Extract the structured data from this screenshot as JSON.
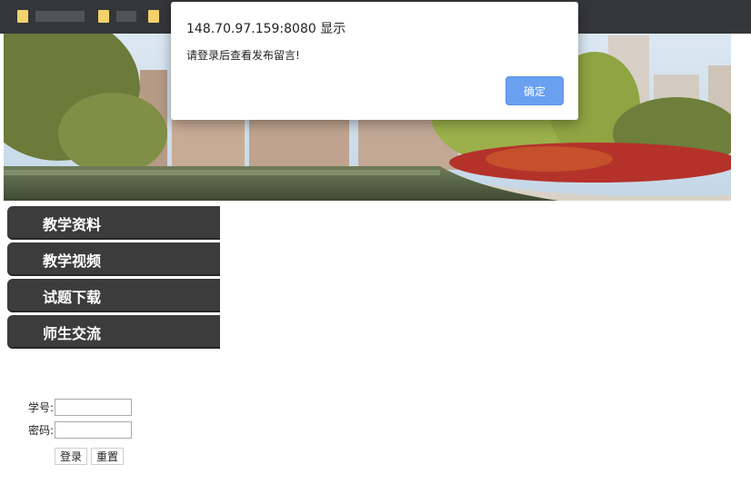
{
  "dialog": {
    "title": "148.70.97.159:8080 显示",
    "message": "请登录后查看发布留言!",
    "ok_label": "确定"
  },
  "nav": {
    "items": [
      {
        "label": "教学资料"
      },
      {
        "label": "教学视频"
      },
      {
        "label": "试题下载"
      },
      {
        "label": "师生交流"
      }
    ]
  },
  "login": {
    "student_id_label": "学号:",
    "password_label": "密码:",
    "login_button": "登录",
    "reset_button": "重置"
  },
  "colors": {
    "bookmarks_bar": "#35363a",
    "nav_item": "#3c3c3c",
    "dialog_button": "#6aa0f0"
  }
}
